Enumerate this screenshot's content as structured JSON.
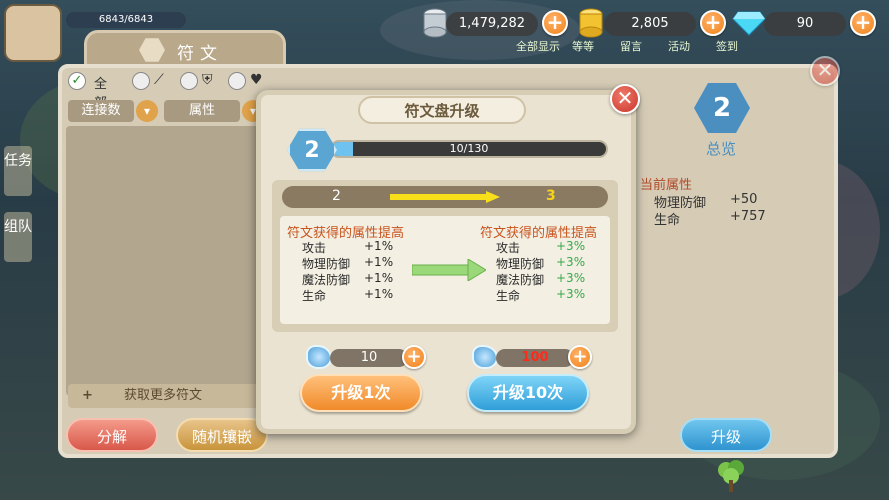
{
  "hud": {
    "player_hp": "6843/6843",
    "silver": "1,479,282",
    "gold": "2,805",
    "diamonds": "90",
    "plus": "+",
    "nav_labels": [
      "全部显示",
      "等等",
      "留言",
      "活动",
      "签到"
    ]
  },
  "rune_panel": {
    "title": "符文",
    "filter_all": "全部",
    "sort_combo": "连接数",
    "sort_attr": "属性",
    "get_more": "获取更多符文",
    "plus": "+",
    "decompose_button": "分解",
    "random_inlay_button": "随机镶嵌",
    "side_tabs": [
      "任务",
      "组队"
    ],
    "level": "2",
    "overview_label": "总览",
    "current_attr_title": "当前属性",
    "current_attrs": [
      {
        "name": "物理防御",
        "value": "+50"
      },
      {
        "name": "生命",
        "value": "+757"
      }
    ],
    "upgrade_button": "升级",
    "close": "✕"
  },
  "upgrade_modal": {
    "title": "符文盘升级",
    "level": "2",
    "progress_text": "10/130",
    "progress_fraction": 0.077,
    "from_level": "2",
    "to_level": "3",
    "left_title": "符文获得的属性提高",
    "right_title": "符文获得的属性提高",
    "left_stats": [
      {
        "name": "攻击",
        "value": "+1%"
      },
      {
        "name": "物理防御",
        "value": "+1%"
      },
      {
        "name": "魔法防御",
        "value": "+1%"
      },
      {
        "name": "生命",
        "value": "+1%"
      }
    ],
    "right_stats": [
      {
        "name": "攻击",
        "value": "+3%"
      },
      {
        "name": "物理防御",
        "value": "+3%"
      },
      {
        "name": "魔法防御",
        "value": "+3%"
      },
      {
        "name": "生命",
        "value": "+3%"
      }
    ],
    "cost_once": "10",
    "cost_ten": "100",
    "upgrade_once_button": "升级1次",
    "upgrade_ten_button": "升级10次",
    "close": "✕"
  },
  "colors": {
    "accent_orange": "#f08a2a",
    "accent_blue": "#2f9ed8",
    "bonus_green": "#36a84a",
    "cost_red": "#ff2a1a"
  }
}
